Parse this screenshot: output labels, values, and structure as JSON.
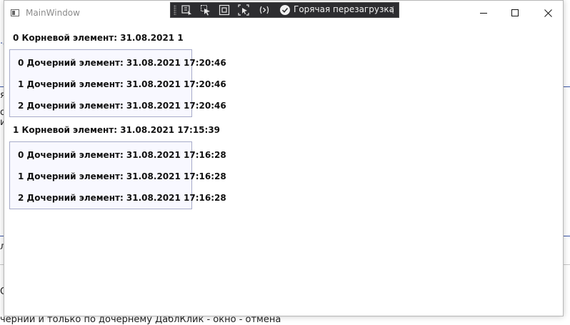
{
  "window": {
    "title": "MainWindow"
  },
  "debug_toolbar": {
    "hot_reload_label": "Горячая перезагрузка"
  },
  "background": {
    "fragments": [
      ".д",
      "яя",
      "о",
      "иı",
      "л",
      "О"
    ],
    "bottom_text": "черний и только по дочернему ДаблКлик - окно - отмена"
  },
  "tree": [
    {
      "label": "0  Корневой элемент: 31.08.2021 1",
      "children": [
        "0  Дочерний элемент: 31.08.2021 17:20:46",
        "1  Дочерний элемент: 31.08.2021 17:20:46",
        "2  Дочерний элемент: 31.08.2021 17:20:46"
      ]
    },
    {
      "label": "1  Корневой элемент: 31.08.2021 17:15:39",
      "children": [
        "0  Дочерний элемент: 31.08.2021 17:16:28",
        "1  Дочерний элемент: 31.08.2021 17:16:28",
        "2  Дочерний элемент: 31.08.2021 17:16:28"
      ]
    }
  ]
}
